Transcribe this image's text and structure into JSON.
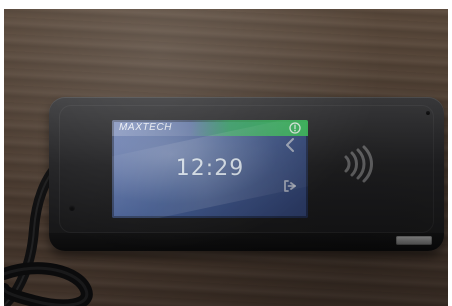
{
  "device": {
    "brand": "MAXTECH",
    "time": "12:29"
  },
  "icons": {
    "status": "status-icon",
    "back": "back-arrow-icon",
    "exit": "exit-icon",
    "nfc": "nfc-contactless-icon"
  },
  "colors": {
    "screen_blue": "#3e5890",
    "topbar_green": "#3cc85a",
    "device_black": "#151516",
    "wood_brown": "#4f3f33"
  }
}
